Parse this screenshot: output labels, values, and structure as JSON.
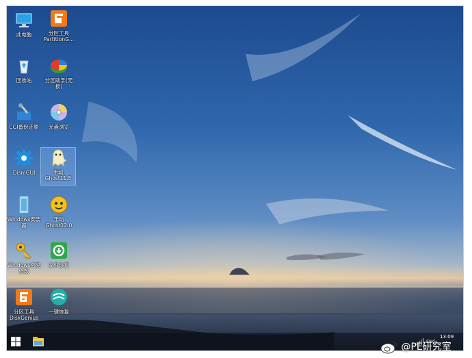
{
  "desktop": {
    "icons": [
      {
        "name": "pc-icon",
        "label": "此电脑"
      },
      {
        "name": "partitionguru-icon",
        "label": "分区工具 PartitionG..."
      },
      {
        "name": "recycle-bin-icon",
        "label": "回收站"
      },
      {
        "name": "partition-assistant-icon",
        "label": "分区助手(无损)"
      },
      {
        "name": "cgi-backup-icon",
        "label": "CGI备份还原"
      },
      {
        "name": "disc-browser-icon",
        "label": "光盘浏览"
      },
      {
        "name": "dism-gear-icon",
        "label": "DismGUI"
      },
      {
        "name": "ghost-115-icon",
        "label": "手动 Ghost11.5"
      },
      {
        "name": "windows-installer-icon",
        "label": "Windows安装器"
      },
      {
        "name": "ghost-120-icon",
        "label": "手动 Ghost12.0"
      },
      {
        "name": "windows-password-icon",
        "label": "Windows密码修改"
      },
      {
        "name": "file-recovery-icon",
        "label": "文件恢复"
      },
      {
        "name": "diskgenius-icon",
        "label": "分区工具 DiskGenius"
      },
      {
        "name": "one-key-restore-icon",
        "label": "一键恢复"
      }
    ]
  },
  "taskbar": {
    "tray_lang": "ENG",
    "clock_time": "13:09"
  },
  "watermark": {
    "text": "@PE研究室"
  }
}
